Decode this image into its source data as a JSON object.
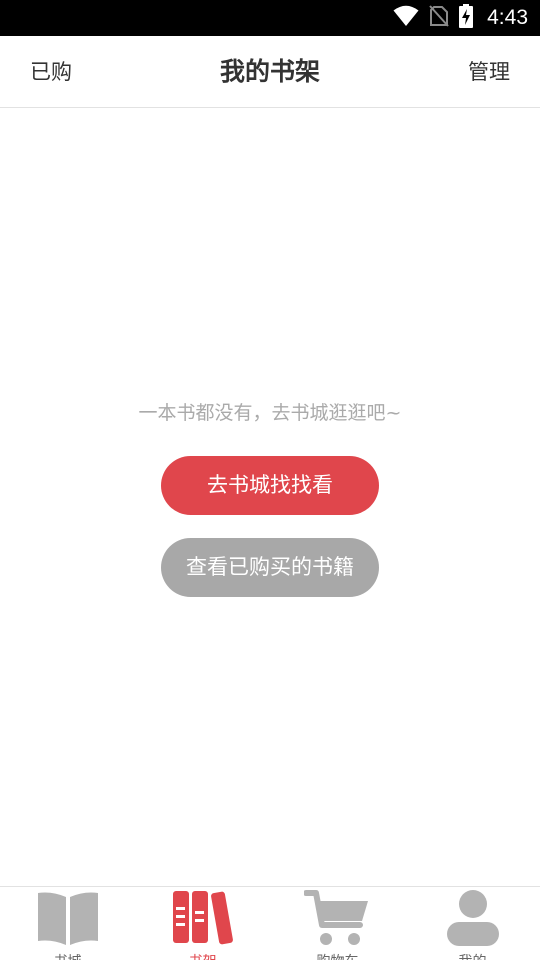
{
  "status_bar": {
    "time": "4:43",
    "icons": [
      "wifi-icon",
      "no-sim-icon",
      "battery-charging-icon"
    ]
  },
  "header": {
    "left_label": "已购",
    "title": "我的书架",
    "right_label": "管理"
  },
  "empty_state": {
    "message": "一本书都没有，去书城逛逛吧~",
    "primary_button": "去书城找找看",
    "secondary_button": "查看已购买的书籍"
  },
  "tabbar": {
    "tabs": [
      {
        "label": "书城",
        "icon": "open-book-icon",
        "active": false
      },
      {
        "label": "书架",
        "icon": "bookshelf-icon",
        "active": true
      },
      {
        "label": "购物车",
        "icon": "cart-icon",
        "active": false
      },
      {
        "label": "我的",
        "icon": "person-icon",
        "active": false
      }
    ]
  },
  "colors": {
    "accent": "#e0464c",
    "inactive_icon": "#b3b3b3",
    "secondary_button": "#a8a8a8"
  }
}
